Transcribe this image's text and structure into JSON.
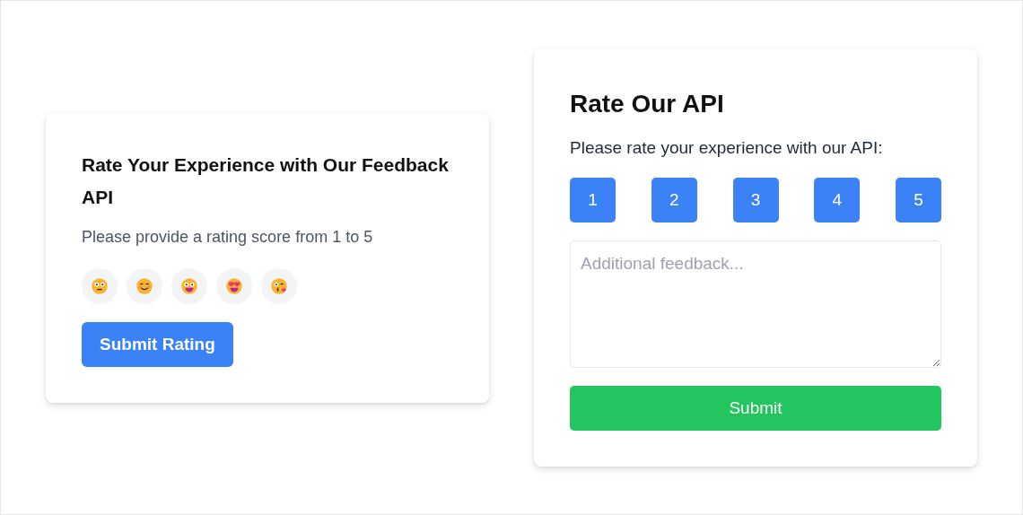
{
  "rating_card": {
    "title": "Rate Your Experience with Our Feedback API",
    "prompt": "Please provide a rating score from 1 to 5",
    "emojis": [
      {
        "kind": "neutral"
      },
      {
        "kind": "smile"
      },
      {
        "kind": "grin"
      },
      {
        "kind": "heart-eyes"
      },
      {
        "kind": "kiss"
      }
    ],
    "submit": "Submit Rating"
  },
  "api_card": {
    "title": "Rate Our API",
    "prompt": "Please rate your experience with our API:",
    "scores": [
      "1",
      "2",
      "3",
      "4",
      "5"
    ],
    "feedback": {
      "placeholder": "Additional feedback..."
    },
    "submit": "Submit"
  }
}
